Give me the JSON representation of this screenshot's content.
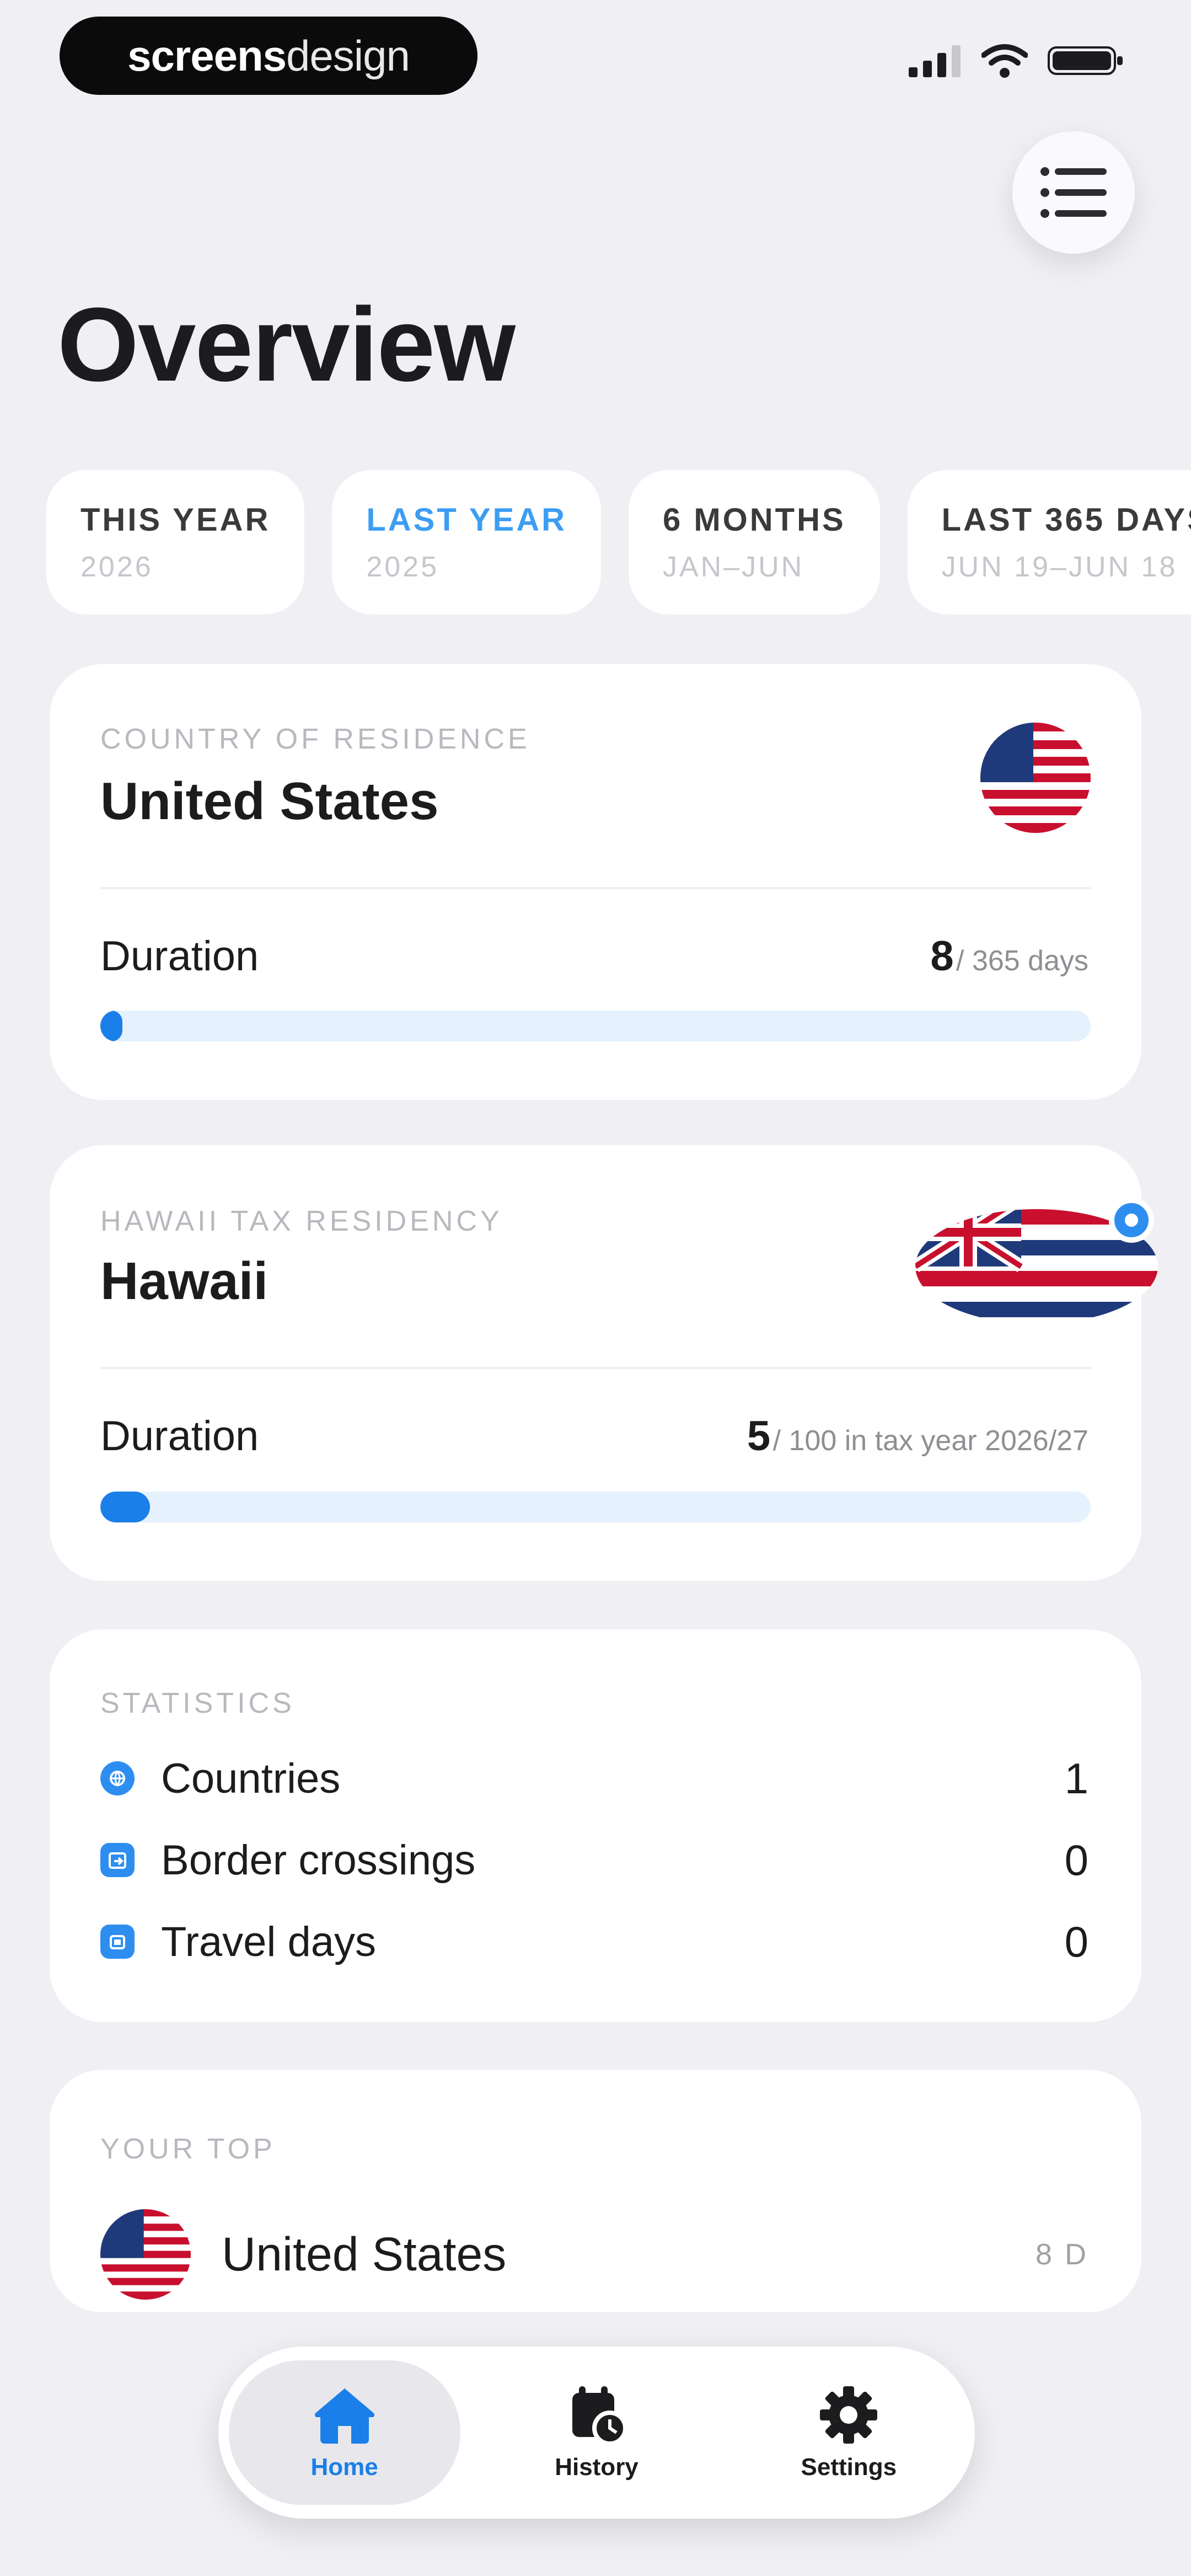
{
  "status_bar": {
    "brand_bold": "screens",
    "brand_light": "design"
  },
  "header": {
    "title": "Overview",
    "menu_icon": "list-icon"
  },
  "periods": [
    {
      "label": "THIS YEAR",
      "sub": "2026",
      "active": false
    },
    {
      "label": "LAST YEAR",
      "sub": "2025",
      "active": true
    },
    {
      "label": "6 MONTHS",
      "sub": "JAN–JUN",
      "active": false
    },
    {
      "label": "LAST 365 DAYS",
      "sub": "JUN 19–JUN 18",
      "active": false
    }
  ],
  "residence": {
    "kicker": "COUNTRY OF RESIDENCE",
    "country": "United States",
    "flag": "us-flag",
    "duration_label": "Duration",
    "duration_value": "8",
    "duration_unit": "/ 365 days",
    "progress_fraction": 0.022
  },
  "tax_residency": {
    "kicker": "HAWAII TAX RESIDENCY",
    "region": "Hawaii",
    "flag": "hawaii-flag",
    "duration_label": "Duration",
    "duration_value": "5",
    "duration_unit": "/ 100 in tax year 2026/27",
    "progress_fraction": 0.05
  },
  "statistics": {
    "kicker": "STATISTICS",
    "rows": [
      {
        "icon": "globe-icon",
        "label": "Countries",
        "value": "1"
      },
      {
        "icon": "border-crossing-icon",
        "label": "Border crossings",
        "value": "0"
      },
      {
        "icon": "travel-days-icon",
        "label": "Travel days",
        "value": "0"
      }
    ]
  },
  "top": {
    "kicker": "YOUR TOP",
    "country": "United States",
    "days": "8 D"
  },
  "tabbar": [
    {
      "label": "Home",
      "icon": "home-icon",
      "active": true
    },
    {
      "label": "History",
      "icon": "history-icon",
      "active": false
    },
    {
      "label": "Settings",
      "icon": "gear-icon",
      "active": false
    }
  ],
  "colors": {
    "accent": "#1a7fe8",
    "accent_light": "#3d9df2",
    "background": "#efeff4",
    "card": "#ffffff"
  }
}
